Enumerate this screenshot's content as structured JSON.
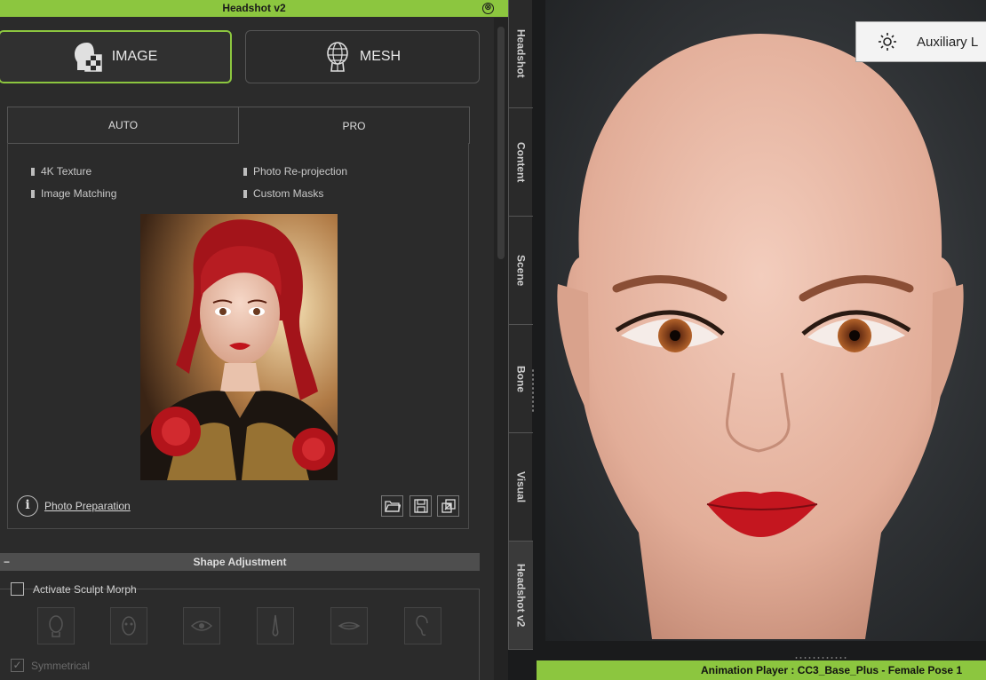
{
  "panel": {
    "title": "Headshot v2",
    "close_symbol": "⊗"
  },
  "modes": {
    "image_label": "IMAGE",
    "mesh_label": "MESH"
  },
  "tabs": {
    "auto_label": "AUTO",
    "pro_label": "PRO"
  },
  "features": [
    "4K Texture",
    "Photo Re-projection",
    "Image Matching",
    "Custom Masks"
  ],
  "photo_prep_label": "Photo Preparation",
  "info_symbol": "i",
  "shape": {
    "header": "Shape Adjustment",
    "collapse_symbol": "−",
    "sculpt_label": "Activate Sculpt Morph",
    "symmetrical_label": "Symmetrical",
    "symmetrical_check": "✓"
  },
  "vertical_tabs": [
    "Headshot",
    "Content",
    "Scene",
    "Bone",
    "Visual",
    "Headshot v2"
  ],
  "viewport": {
    "aux_label": "Auxiliary L"
  },
  "status_bar": "Animation Player : CC3_Base_Plus - Female Pose 1",
  "colors": {
    "accent": "#8cc63f",
    "panel_bg": "#2b2b2b"
  }
}
